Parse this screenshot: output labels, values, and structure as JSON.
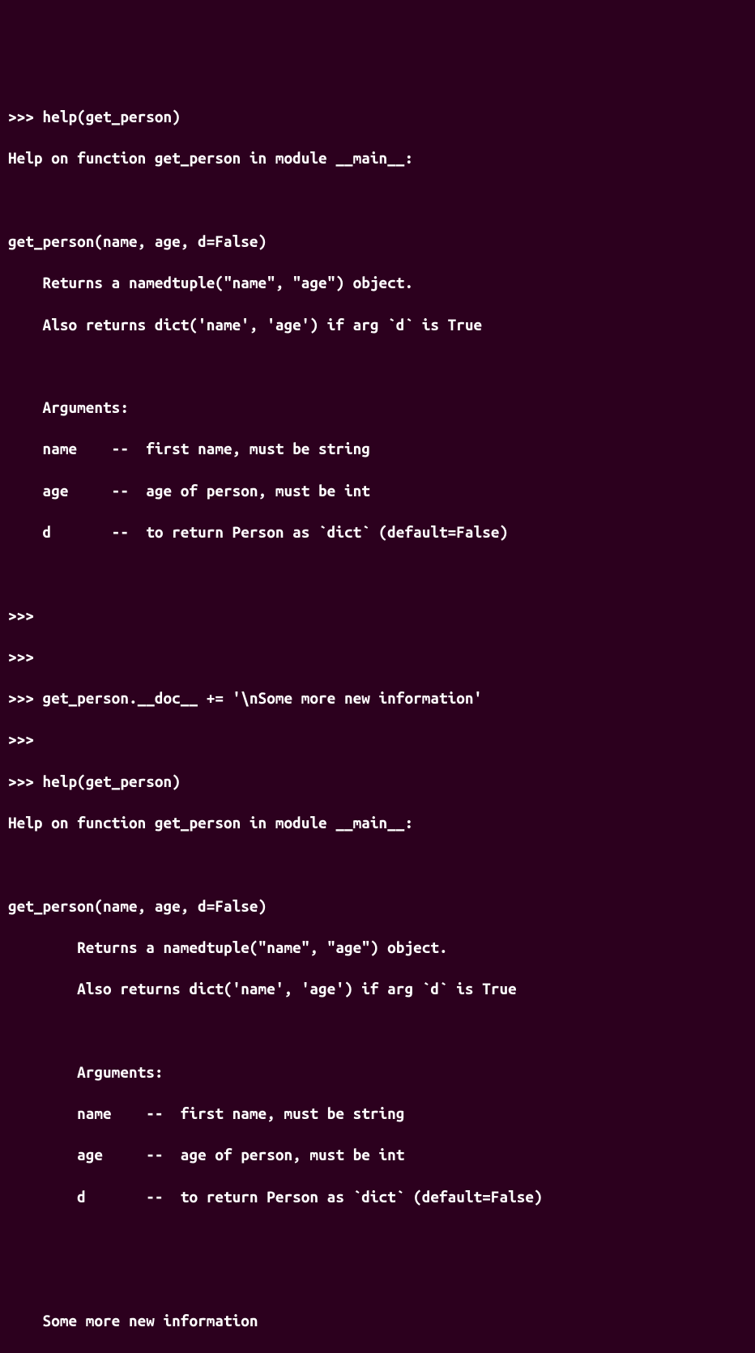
{
  "terminal": {
    "lines": [
      ">>> help(get_person)",
      "Help on function get_person in module __main__:",
      "",
      "get_person(name, age, d=False)",
      "    Returns a namedtuple(\"name\", \"age\") object.",
      "    Also returns dict('name', 'age') if arg `d` is True",
      "",
      "    Arguments:",
      "    name    --  first name, must be string",
      "    age     --  age of person, must be int",
      "    d       --  to return Person as `dict` (default=False)",
      "",
      ">>>",
      ">>>",
      ">>> get_person.__doc__ += '\\nSome more new information'",
      ">>>",
      ">>> help(get_person)",
      "Help on function get_person in module __main__:",
      "",
      "get_person(name, age, d=False)",
      "        Returns a namedtuple(\"name\", \"age\") object.",
      "        Also returns dict('name', 'age') if arg `d` is True",
      "",
      "        Arguments:",
      "        name    --  first name, must be string",
      "        age     --  age of person, must be int",
      "        d       --  to return Person as `dict` (default=False)",
      "",
      "",
      "    Some more new information"
    ]
  }
}
